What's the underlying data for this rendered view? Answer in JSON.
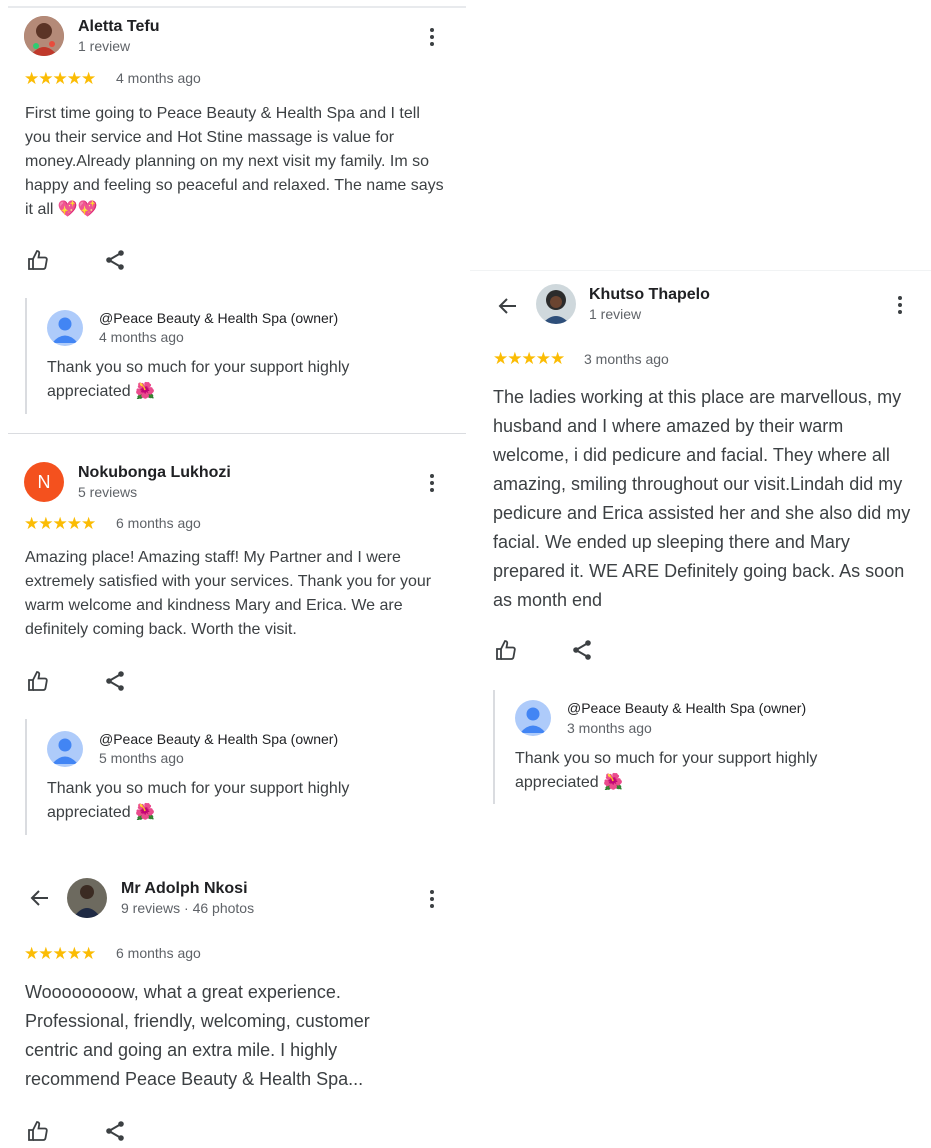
{
  "reviews_left": [
    {
      "name": "Aletta Tefu",
      "meta": "1 review",
      "stars": "★★★★★",
      "rating": 5,
      "when": "4 months ago",
      "text": "First time going to Peace Beauty & Health Spa and I tell you their service and Hot Stine massage is value for money.Already planning on my next visit my family. Im so happy and feeling so peaceful and relaxed. The name says it all",
      "emoji": "💖💖",
      "reply": {
        "name": "@Peace Beauty & Health Spa (owner)",
        "when": "4 months ago",
        "text": "Thank you so much for your support highly appreciated",
        "emoji": "🌺"
      }
    },
    {
      "name": "Nokubonga Lukhozi",
      "initial": "N",
      "meta": "5 reviews",
      "stars": "★★★★★",
      "rating": 5,
      "when": "6 months ago",
      "text": "Amazing place! Amazing staff! My Partner and I were extremely satisfied with your services. Thank you for your warm welcome and kindness Mary and Erica. We are definitely coming back. Worth the visit.",
      "reply": {
        "name": "@Peace Beauty & Health Spa (owner)",
        "when": "5 months ago",
        "text": "Thank you so much for your support highly appreciated",
        "emoji": "🌺"
      }
    },
    {
      "name": "Mr Adolph Nkosi",
      "meta": "9 reviews · 46 photos",
      "stars": "★★★★★",
      "rating": 5,
      "when": "6 months ago",
      "text": "Woooooooow, what a great experience. Professional, friendly, welcoming, customer centric and going an extra mile. I highly recommend Peace Beauty & Health Spa..."
    }
  ],
  "review_right": {
    "name": "Khutso Thapelo",
    "meta": "1 review",
    "stars": "★★★★★",
    "rating": 5,
    "when": "3 months ago",
    "text": "The ladies working at this place are marvellous, my husband and I where amazed by their warm welcome, i did pedicure and facial. They where all amazing, smiling throughout our visit.Lindah did my pedicure and Erica assisted her and she also did my facial. We ended up sleeping there and Mary prepared it. WE ARE Definitely going back. As soon as month end",
    "reply": {
      "name": "@Peace Beauty & Health Spa (owner)",
      "when": "3 months ago",
      "text": "Thank you so much for your support highly appreciated",
      "emoji": "🌺"
    }
  },
  "icons": {
    "like": "thumbs-up-icon",
    "share": "share-icon",
    "more": "more-vert-icon",
    "back": "arrow-back-icon"
  },
  "colors": {
    "star": "#fbbc04",
    "initial_avatar": "#f4511e",
    "owner_avatar": "#aecbfa"
  }
}
